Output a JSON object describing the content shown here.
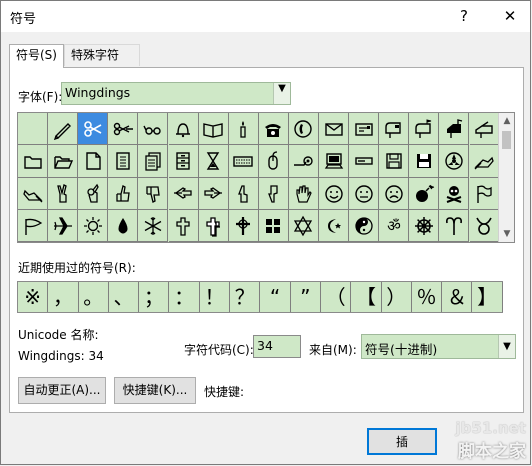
{
  "window": {
    "title": "符号",
    "help_label": "?",
    "close_label": "✕"
  },
  "tabs": [
    {
      "label": "符号(S)",
      "active": true
    },
    {
      "label": "特殊字符(P)",
      "active": false
    }
  ],
  "font": {
    "label": "字体(F):",
    "value": "Wingdings"
  },
  "symbol_grid": {
    "selected_index": 2,
    "rows": [
      [
        "blank-symbol",
        "pencil-symbol",
        "scissors-symbol",
        "scissors-cutting-symbol",
        "glasses-symbol",
        "bell-symbol",
        "book-open-symbol",
        "candle-symbol",
        "telephone-symbol",
        "telephone-location-symbol",
        "envelope-symbol",
        "envelope-back-symbol",
        "mailbox-closed-symbol",
        "mailbox-flag-symbol",
        "mailbox-open-flag-symbol",
        "mailbox-open-symbol"
      ],
      [
        "folder-symbol",
        "folder-open-symbol",
        "page-curl-symbol",
        "page-symbol",
        "pages-symbol",
        "file-cabinet-symbol",
        "hourglass-symbol",
        "keyboard-symbol",
        "mouse-symbol",
        "trackball-symbol",
        "computer-symbol",
        "hard-disk-symbol",
        "floppy-white-symbol",
        "floppy-black-symbol",
        "tape-drive-symbol",
        "writing-hand-symbol"
      ],
      [
        "writing-hand-left-symbol",
        "victory-hand-symbol",
        "ok-hand-symbol",
        "thumbs-up-symbol",
        "thumbs-down-symbol",
        "point-left-symbol",
        "point-right-symbol",
        "point-up-symbol",
        "point-down-symbol",
        "open-hand-symbol",
        "smiley-symbol",
        "neutral-face-symbol",
        "frown-face-symbol",
        "bomb-symbol",
        "skull-symbol",
        "flag-symbol"
      ],
      [
        "pennant-symbol",
        "airplane-symbol",
        "sun-symbol",
        "droplet-symbol",
        "snowflake-symbol",
        "latin-cross-symbol",
        "shadowed-cross-symbol",
        "celtic-cross-symbol",
        "maltese-cross-symbol",
        "star-of-david-symbol",
        "crescent-star-symbol",
        "yin-yang-symbol",
        "om-symbol",
        "dharma-wheel-symbol",
        "aries-symbol",
        "taurus-symbol"
      ]
    ]
  },
  "recent": {
    "label": "近期使用过的符号(R):",
    "symbols": [
      "※",
      "，",
      "。",
      "、",
      "；",
      "：",
      "！",
      "？",
      "“",
      "”",
      "（",
      "【",
      "）",
      "％",
      "＆",
      "】"
    ]
  },
  "unicode_name": {
    "label": "Unicode 名称:",
    "value": "Wingdings: 34"
  },
  "char_code": {
    "label": "字符代码(C):",
    "value": "34"
  },
  "from": {
    "label": "来自(M):",
    "value": "符号(十进制)"
  },
  "buttons": {
    "autocorrect": "自动更正(A)...",
    "shortcut_key": "快捷键(K)...",
    "shortcut_label": "快捷键:",
    "insert": "插"
  },
  "watermark": {
    "line1": "jb51.net",
    "line2": "脚本之家"
  }
}
